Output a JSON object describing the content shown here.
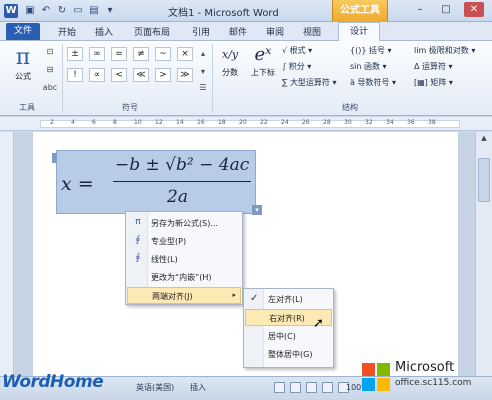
{
  "titlebar": {
    "app_letter": "W",
    "title": "文档1 - Microsoft Word",
    "context_tab": "公式工具",
    "minimize": "–",
    "restore": "□",
    "close": "✕"
  },
  "tabs": {
    "file": "文件",
    "items": [
      "开始",
      "插入",
      "页面布局",
      "引用",
      "邮件",
      "审阅",
      "视图"
    ],
    "active": "设计"
  },
  "ribbon": {
    "tools_group": {
      "equation_label": "公式",
      "label": "工具",
      "abc_label": "abc"
    },
    "symbols_group": {
      "label": "符号",
      "row1": [
        "±",
        "∞",
        "=",
        "≠",
        "~",
        "×"
      ],
      "row2": [
        "!",
        "∝",
        "<",
        "≪",
        ">",
        "≫"
      ]
    },
    "structures_group": {
      "label": "结构",
      "fraction": {
        "glyph": "x/y",
        "label": "分数"
      },
      "script": {
        "glyph": "eˣ",
        "label": "上下标"
      },
      "radical": "根式",
      "integral": "积分",
      "large_operator": "大型运算符",
      "bracket": "括号",
      "function": "函数",
      "accent": "导数符号",
      "limit_log": "极限和对数",
      "operator": "运算符",
      "matrix": "矩阵"
    }
  },
  "equation": {
    "lhs": "x =",
    "numerator": "−b ± √b² − 4ac",
    "denominator": "2a"
  },
  "context_menu": {
    "items": [
      {
        "label": "另存为新公式(S)...",
        "icon": "save-equation-icon"
      },
      {
        "label": "专业型(P)",
        "icon": "professional-icon"
      },
      {
        "label": "线性(L)",
        "icon": "linear-icon"
      },
      {
        "label": "更改为“内嵌”(H)",
        "icon": ""
      },
      {
        "label": "两端对齐(J)",
        "icon": "",
        "has_submenu": true
      }
    ],
    "submenu_arrow": "▸"
  },
  "submenu": {
    "items": [
      "左对齐(L)",
      "右对齐(R)",
      "居中(C)",
      "整体居中(G)"
    ],
    "checked_index": 0,
    "highlighted_index": 1,
    "check_glyph": "✓"
  },
  "statusbar": {
    "language": "英语(美国)",
    "mode": "插入",
    "zoom": "100%"
  },
  "watermarks": {
    "wordhome": "WordHome",
    "ms_brand": "Microsoft",
    "ms_site": "office.sc115.com"
  },
  "colors": {
    "accent": "#2a5eb4",
    "context_tab": "#f0a92b",
    "equation_selection": "#b8cce8",
    "menu_highlight": "#fce9b4"
  }
}
